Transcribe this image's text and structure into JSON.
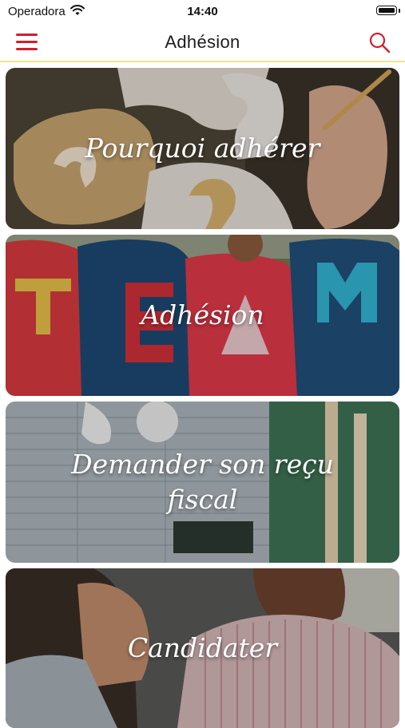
{
  "status_bar": {
    "carrier": "Operadora",
    "time": "14:40"
  },
  "nav": {
    "title": "Adhésion",
    "menu_icon": "hamburger-menu-icon",
    "search_icon": "search-icon",
    "accent_color": "#d41d2b",
    "divider_color": "#f1e58a"
  },
  "cards": [
    {
      "label": "Pourquoi adhérer",
      "image": "question-marks-photo"
    },
    {
      "label": "Adhésion",
      "image": "team-shirts-photo"
    },
    {
      "label": "Demander son reçu fiscal",
      "image": "tax-form-photo"
    },
    {
      "label": "Candidater",
      "image": "interview-photo"
    }
  ]
}
